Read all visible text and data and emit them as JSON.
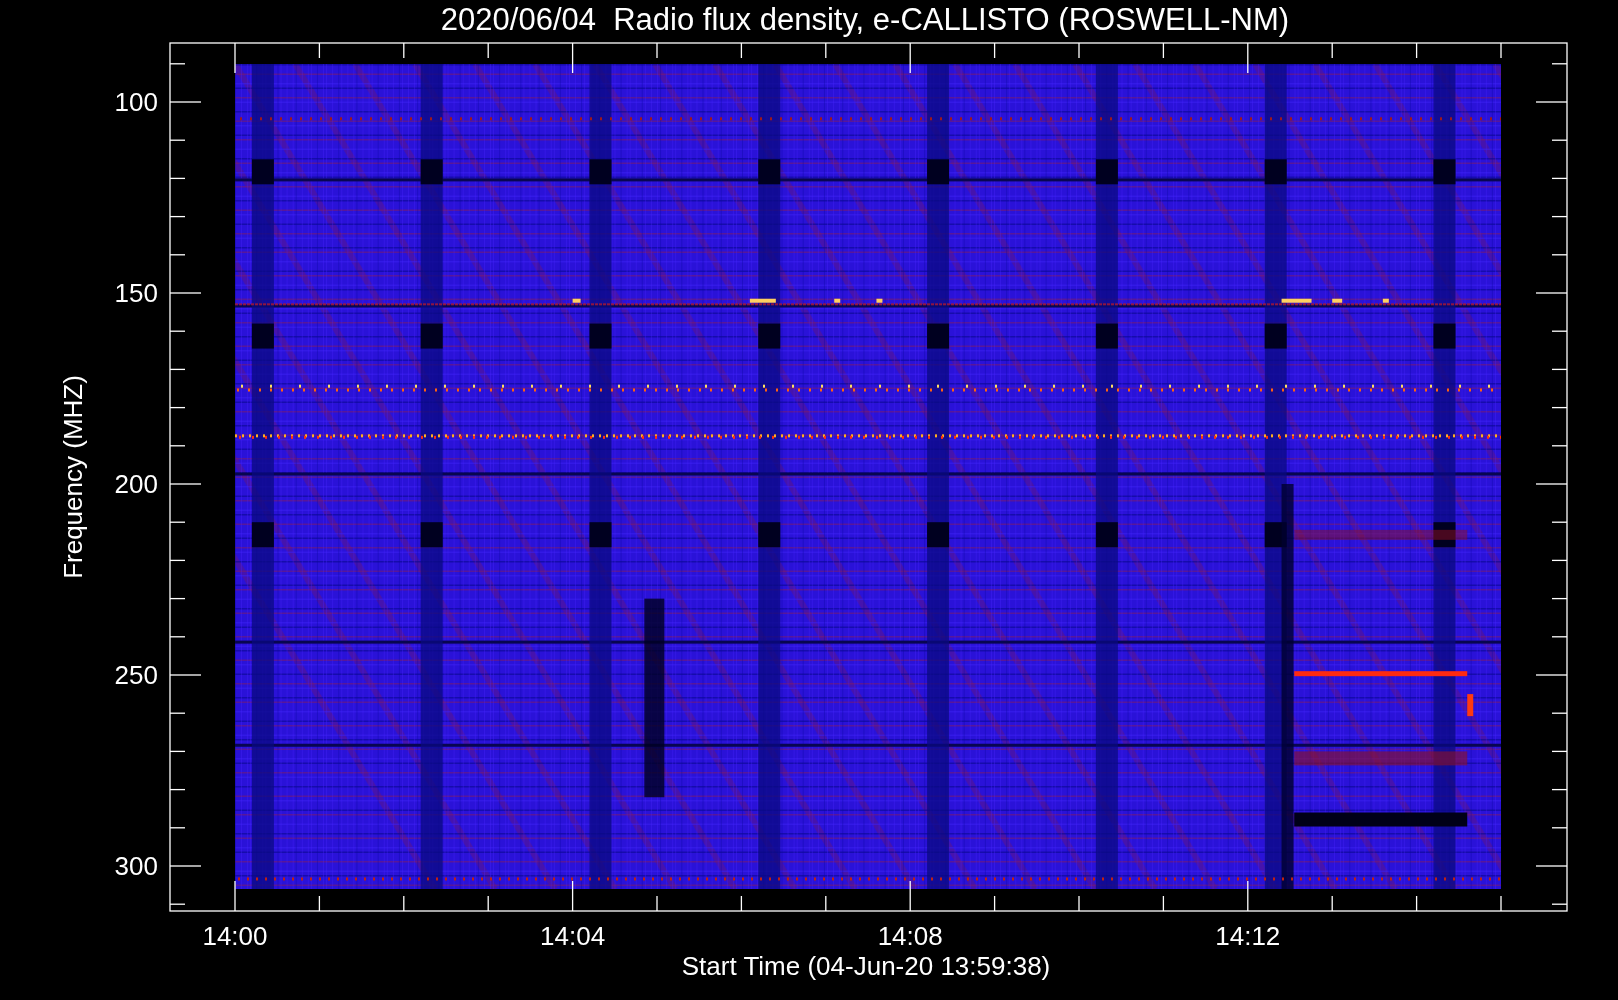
{
  "title": "2020/06/04  Radio flux density, e-CALLISTO (ROSWELL-NM)",
  "y_axis": {
    "label": "Frequency (MHZ)",
    "ticks": [
      "100",
      "150",
      "200",
      "250",
      "300"
    ]
  },
  "x_axis": {
    "label": "Start Time (04-Jun-20 13:59:38)",
    "ticks": [
      "14:00",
      "14:04",
      "14:08",
      "14:12"
    ]
  }
}
